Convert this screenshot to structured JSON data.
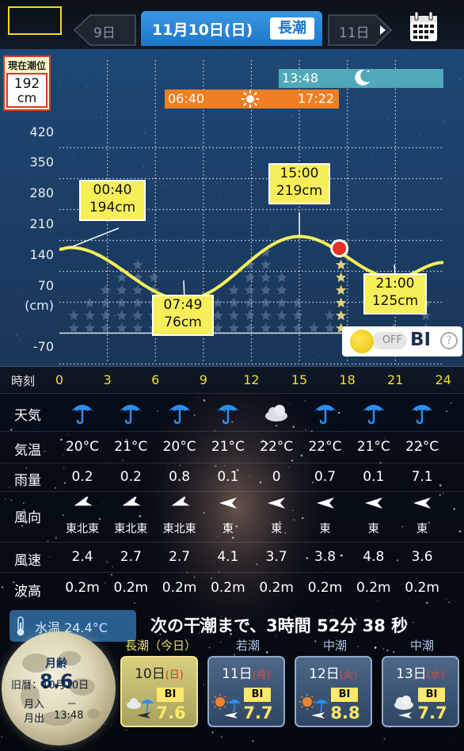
{
  "header": {
    "prev_day": "9日",
    "date": "11月10日(日)",
    "tide_type": "長潮",
    "next_day": "11日"
  },
  "current": {
    "title": "現在潮位",
    "value": "192",
    "unit": "cm"
  },
  "y_ticks": [
    "420",
    "350",
    "280",
    "210",
    "140",
    "70",
    "(cm)",
    "-70"
  ],
  "moonrise": "13:48",
  "sun": {
    "rise": "06:40",
    "set": "17:22"
  },
  "tide_labels": [
    {
      "time": "00:40",
      "height": "194cm"
    },
    {
      "time": "07:49",
      "height": "76cm"
    },
    {
      "time": "15:00",
      "height": "219cm"
    },
    {
      "time": "21:00",
      "height": "125cm"
    }
  ],
  "bi_toggle": {
    "state": "OFF",
    "label": "BI",
    "help": "?"
  },
  "time_axis": {
    "label": "時刻",
    "ticks": [
      "0",
      "3",
      "6",
      "9",
      "12",
      "15",
      "18",
      "21",
      "24"
    ]
  },
  "chart_data": {
    "type": "line",
    "x": [
      0,
      0.6667,
      7.8167,
      15.0,
      21.0,
      24
    ],
    "y": [
      190,
      194,
      76,
      219,
      125,
      160
    ],
    "ylim": [
      -70,
      420
    ],
    "xlim": [
      0,
      24
    ],
    "current_point": {
      "x": 17.5,
      "y": 192
    },
    "grid": true
  },
  "weather": {
    "labels": {
      "sky": "天気",
      "temp": "気温",
      "rain": "雨量",
      "wind_dir": "風向",
      "wind_speed": "風速",
      "wave": "波高"
    },
    "sky": [
      "umbrella",
      "umbrella",
      "umbrella",
      "umbrella",
      "cloud",
      "umbrella",
      "umbrella",
      "umbrella"
    ],
    "temp": [
      "20°C",
      "21°C",
      "20°C",
      "21°C",
      "22°C",
      "22°C",
      "21°C",
      "22°C"
    ],
    "rain": [
      "0.2",
      "0.2",
      "0.8",
      "0.1",
      "0",
      "0.7",
      "0.1",
      "7.1"
    ],
    "wind_dir": [
      "東北東",
      "東北東",
      "東北東",
      "東",
      "東",
      "東",
      "東",
      "東"
    ],
    "wind_speed": [
      "2.4",
      "2.7",
      "2.7",
      "4.1",
      "3.7",
      "3.8",
      "4.8",
      "3.6"
    ],
    "wave": [
      "0.2m",
      "0.2m",
      "0.2m",
      "0.2m",
      "0.2m",
      "0.2m",
      "0.2m",
      "0.2m"
    ]
  },
  "water_temp": "水温 24.4°C",
  "countdown": "次の干潮まで、3時間 52分 38 秒",
  "moon": {
    "age_label": "月齢",
    "age": "8.6",
    "lunar_date": "旧暦：10月10日",
    "moonset_label": "月入",
    "moonset": "－",
    "moonrise_label": "月出",
    "moonrise": "13:48"
  },
  "day_cards": [
    {
      "tag": "長潮（今日）",
      "day": "10日",
      "weekday": "(日)",
      "bi": "BI",
      "value": "7.6",
      "icon": "cloud-rain"
    },
    {
      "tag": "若潮",
      "day": "11日",
      "weekday": "(月)",
      "bi": "BI",
      "value": "7.7",
      "icon": "sun-rain"
    },
    {
      "tag": "中潮",
      "day": "12日",
      "weekday": "(火)",
      "bi": "BI",
      "value": "8.8",
      "icon": "sun-rain"
    },
    {
      "tag": "中潮",
      "day": "13日",
      "weekday": "(水)",
      "bi": "BI",
      "value": "7.7",
      "icon": "cloud"
    }
  ],
  "colors": {
    "accent_blue": "#1d76c8",
    "tide_line": "#f6ef59",
    "time_ticks": "#f3de2c",
    "sun_bar": "#f07f22",
    "moon_bar": "#4fa9b8"
  }
}
